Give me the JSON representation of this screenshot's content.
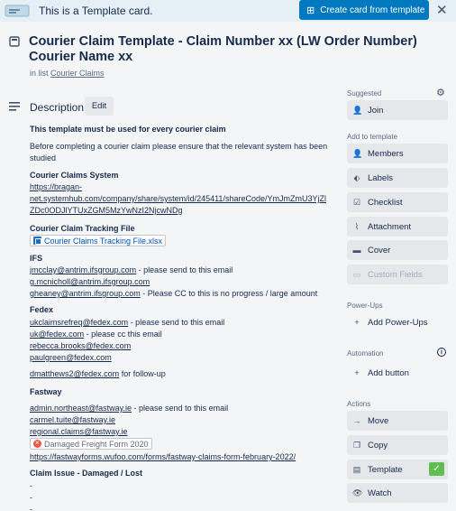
{
  "banner": {
    "text": "This is a Template card.",
    "create_label": "Create card from template",
    "icon": "template-card-icon",
    "accent": "#0079bf"
  },
  "card": {
    "title": "Courier Claim Template - Claim Number xx (LW Order Number) Courier Name xx",
    "in_list_prefix": "in list",
    "list_name": "Courier Claims"
  },
  "description": {
    "heading": "Description",
    "edit_label": "Edit",
    "intro_bold": "This template must be used for every courier claim",
    "intro_text": "Before completing a courier claim please ensure that the relevant system has been",
    "intro_text2": "studied",
    "systems_heading": "Courier Claims System",
    "systems_link1": "https://bragan-",
    "systems_link2": "net.systemhub.com/company/share/system/id/245411/shareCode/YmJmZmU3YjZl",
    "systems_link3": "ZDc0ODJlYTUxZGM5MzYwNzI2NjcwNDg",
    "tracking_heading": "Courier Claim Tracking File",
    "tracking_file": "Courier Claims Tracking File.xlsx",
    "ifs_heading": "IFS",
    "ifs_1_email": "jmcclay@antrim.ifsgroup.com",
    "ifs_1_note": " - please send to this email",
    "ifs_2_email": "g.mcnicholl@antrim.ifsgroup.com",
    "ifs_3_email": "gheaney@antrim.ifsgroup.com",
    "ifs_3_note": " - Please CC to this is no progress / large amount",
    "fedex_heading": "Fedex",
    "fedex_1_email": "ukclaimsrefreq@fedex.com",
    "fedex_1_note": " - please send to this email",
    "fedex_2_email": "uk@fedex.com",
    "fedex_2_note": " - please cc this email",
    "fedex_3_email": "rebecca.brooks@fedex.com",
    "fedex_4_email": "paulgreen@fedex.com",
    "fedex_5_email": "dmatthews2@fedex.com",
    "fedex_5_note": " for follow-up",
    "fastway_heading": "Fastway",
    "fastway_1_email": "admin.northeast@fastway.ie",
    "fastway_1_note": " - please send to this email",
    "fastway_2_email": "carmel.tuite@fastway.ie",
    "fastway_3_email": "regional.claims@fastway.ie",
    "fastway_form": "Damaged Freight Form 2020",
    "fastway_form_url": "https://fastwayforms.wufoo.com/forms/fastway-claims-form-february-2022/",
    "issue_heading": "Claim Issue - Damaged / Lost",
    "dash": "-"
  },
  "sidebar": {
    "suggested_label": "Suggested",
    "join_label": "Join",
    "add_to_template_label": "Add to template",
    "members_label": "Members",
    "labels_label": "Labels",
    "checklist_label": "Checklist",
    "attachment_label": "Attachment",
    "cover_label": "Cover",
    "custom_fields_label": "Custom Fields",
    "powerups_label": "Power-Ups",
    "add_powerups_label": "Add Power-Ups",
    "automation_label": "Automation",
    "add_button_label": "Add button",
    "actions_label": "Actions",
    "move_label": "Move",
    "copy_label": "Copy",
    "template_label": "Template",
    "watch_label": "Watch",
    "template_badge_color": "#61bd4f"
  }
}
